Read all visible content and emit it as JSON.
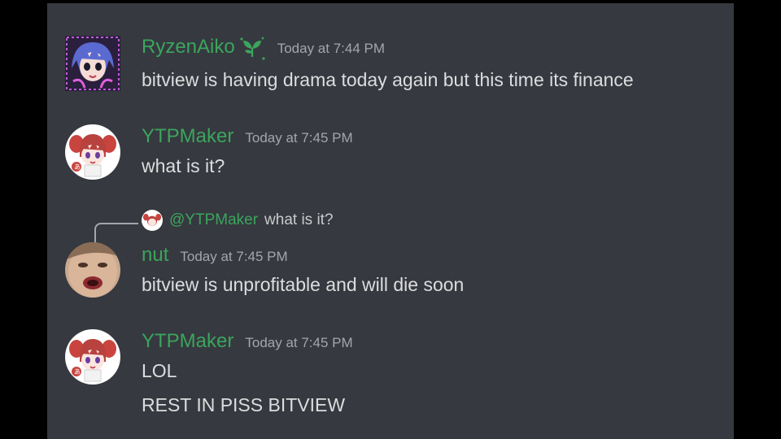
{
  "colors": {
    "username": "#3ba55d",
    "timestamp": "#a3a6aa",
    "text": "#dcddde",
    "background": "#36393f"
  },
  "messages": [
    {
      "author": "RyzenAiko",
      "author_badge": "sprout-icon",
      "timestamp": "Today at 7:44 PM",
      "lines": [
        "bitview is having drama today again but this time its finance"
      ]
    },
    {
      "author": "YTPMaker",
      "timestamp": "Today at 7:45 PM",
      "lines": [
        "what is it?"
      ]
    },
    {
      "reply_to": {
        "mention": "@YTPMaker",
        "text": "what is it?"
      },
      "author": "nut",
      "timestamp": "Today at 7:45 PM",
      "lines": [
        "bitview is unprofitable and will die soon"
      ]
    },
    {
      "author": "YTPMaker",
      "timestamp": "Today at 7:45 PM",
      "lines": [
        "LOL",
        "REST IN PISS BITVIEW"
      ]
    }
  ]
}
